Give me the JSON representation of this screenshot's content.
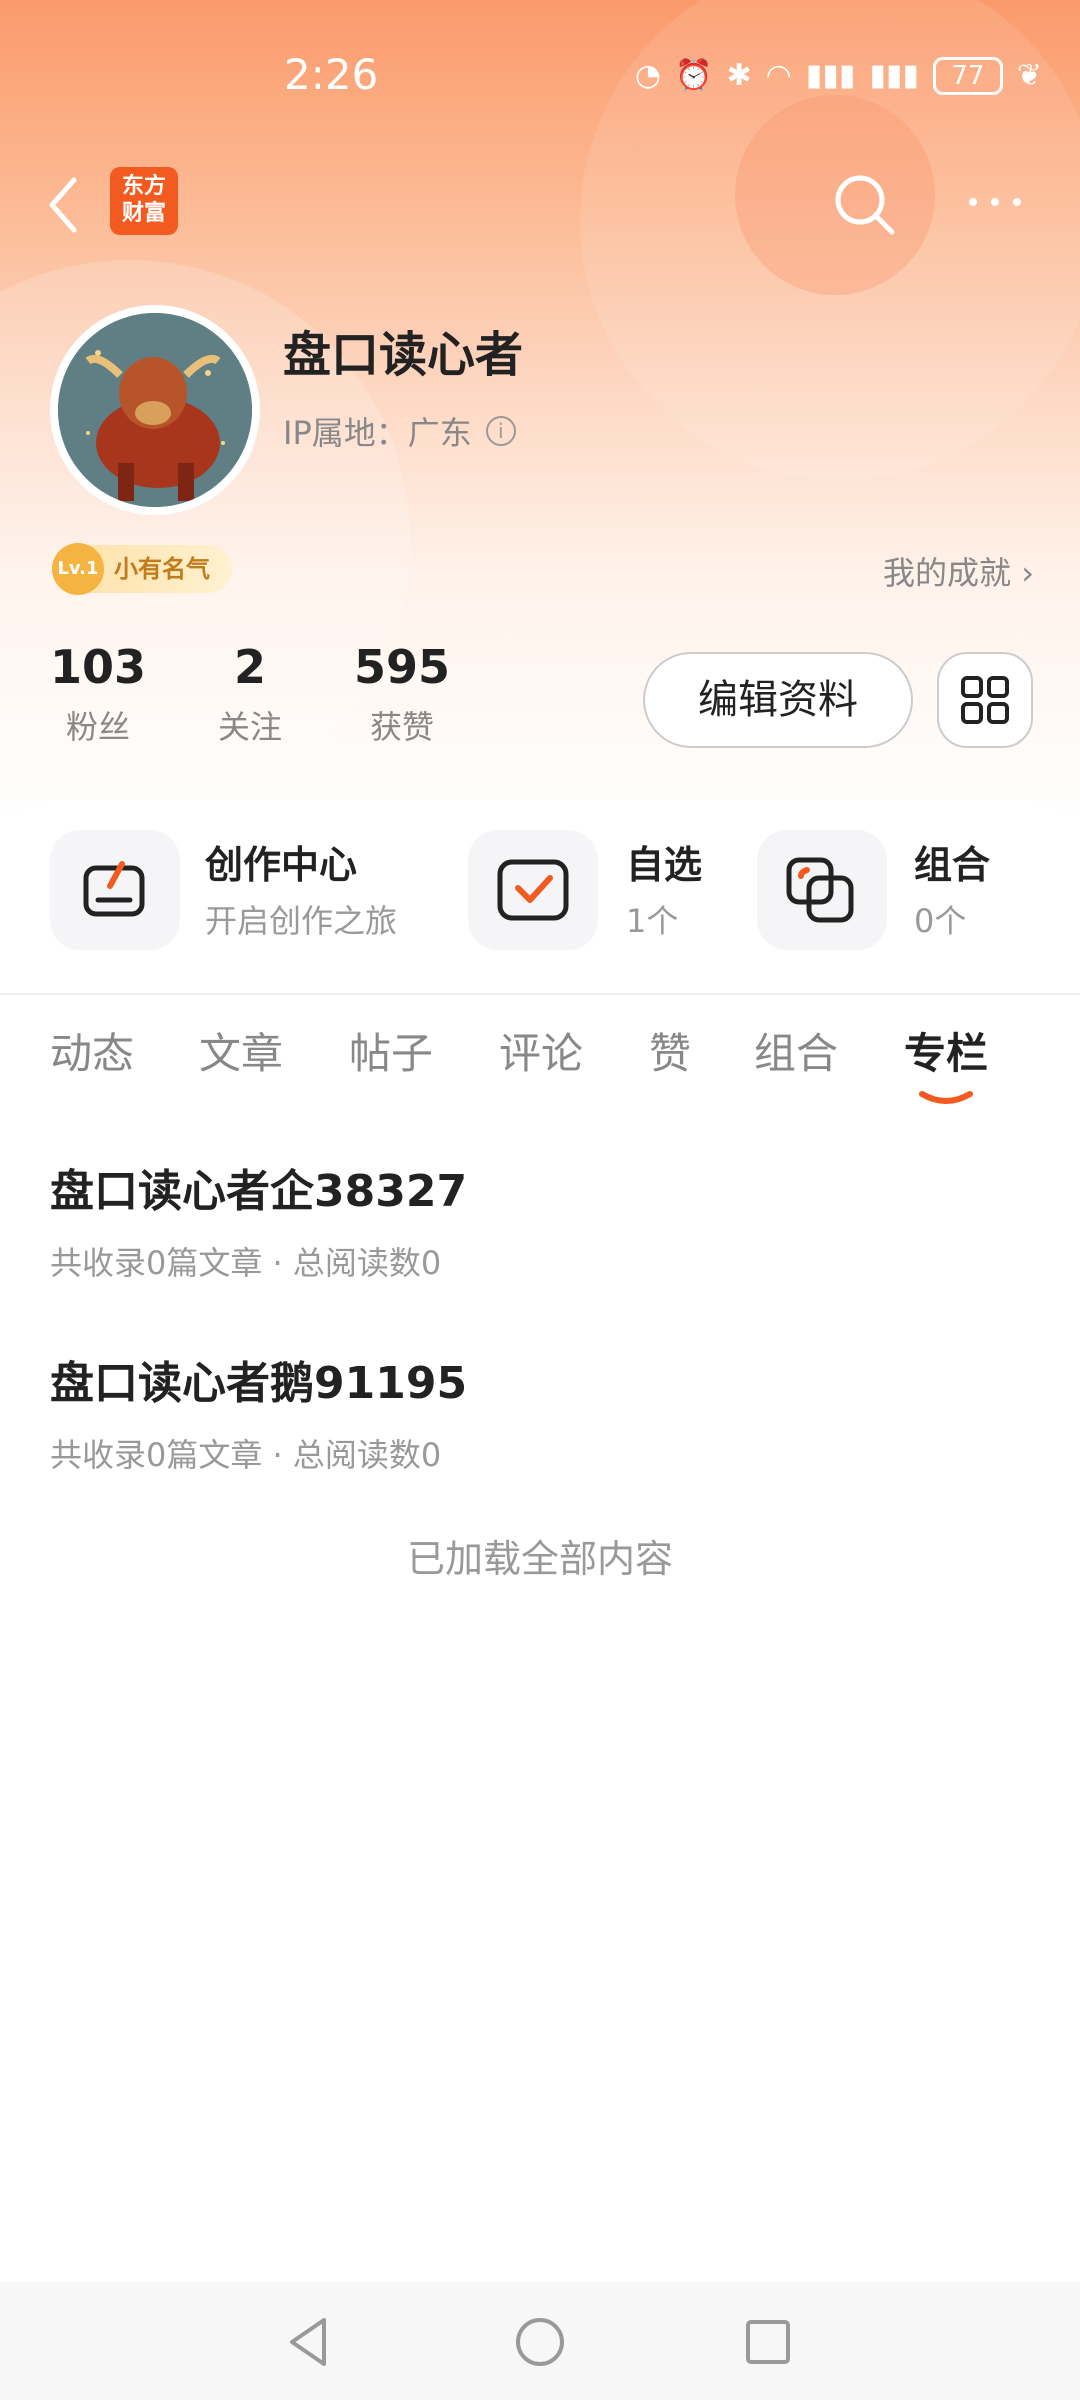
{
  "status_bar": {
    "time": "2:26",
    "battery": "77"
  },
  "nav": {
    "logo_line1": "东方",
    "logo_line2": "财富"
  },
  "profile": {
    "name": "盘口读心者",
    "ip_label": "IP属地：",
    "ip_location": "广东",
    "level_tag": "Lv.1",
    "level_title": "小有名气",
    "achievement_link": "我的成就"
  },
  "stats": [
    {
      "value": "103",
      "label": "粉丝"
    },
    {
      "value": "2",
      "label": "关注"
    },
    {
      "value": "595",
      "label": "获赞"
    }
  ],
  "actions": {
    "edit_profile": "编辑资料"
  },
  "tiles": [
    {
      "title": "创作中心",
      "subtitle": "开启创作之旅"
    },
    {
      "title": "自选",
      "subtitle": "1个"
    },
    {
      "title": "组合",
      "subtitle": "0个"
    }
  ],
  "tabs": [
    "动态",
    "文章",
    "帖子",
    "评论",
    "赞",
    "组合",
    "专栏"
  ],
  "active_tab": "专栏",
  "columns": [
    {
      "title": "盘口读心者企38327",
      "meta": "共收录0篇文章 · 总阅读数0"
    },
    {
      "title": "盘口读心者鹅91195",
      "meta": "共收录0篇文章 · 总阅读数0"
    }
  ],
  "footer_text": "已加载全部内容",
  "colors": {
    "accent": "#f25a1f",
    "header_top": "#fb9a6c"
  }
}
